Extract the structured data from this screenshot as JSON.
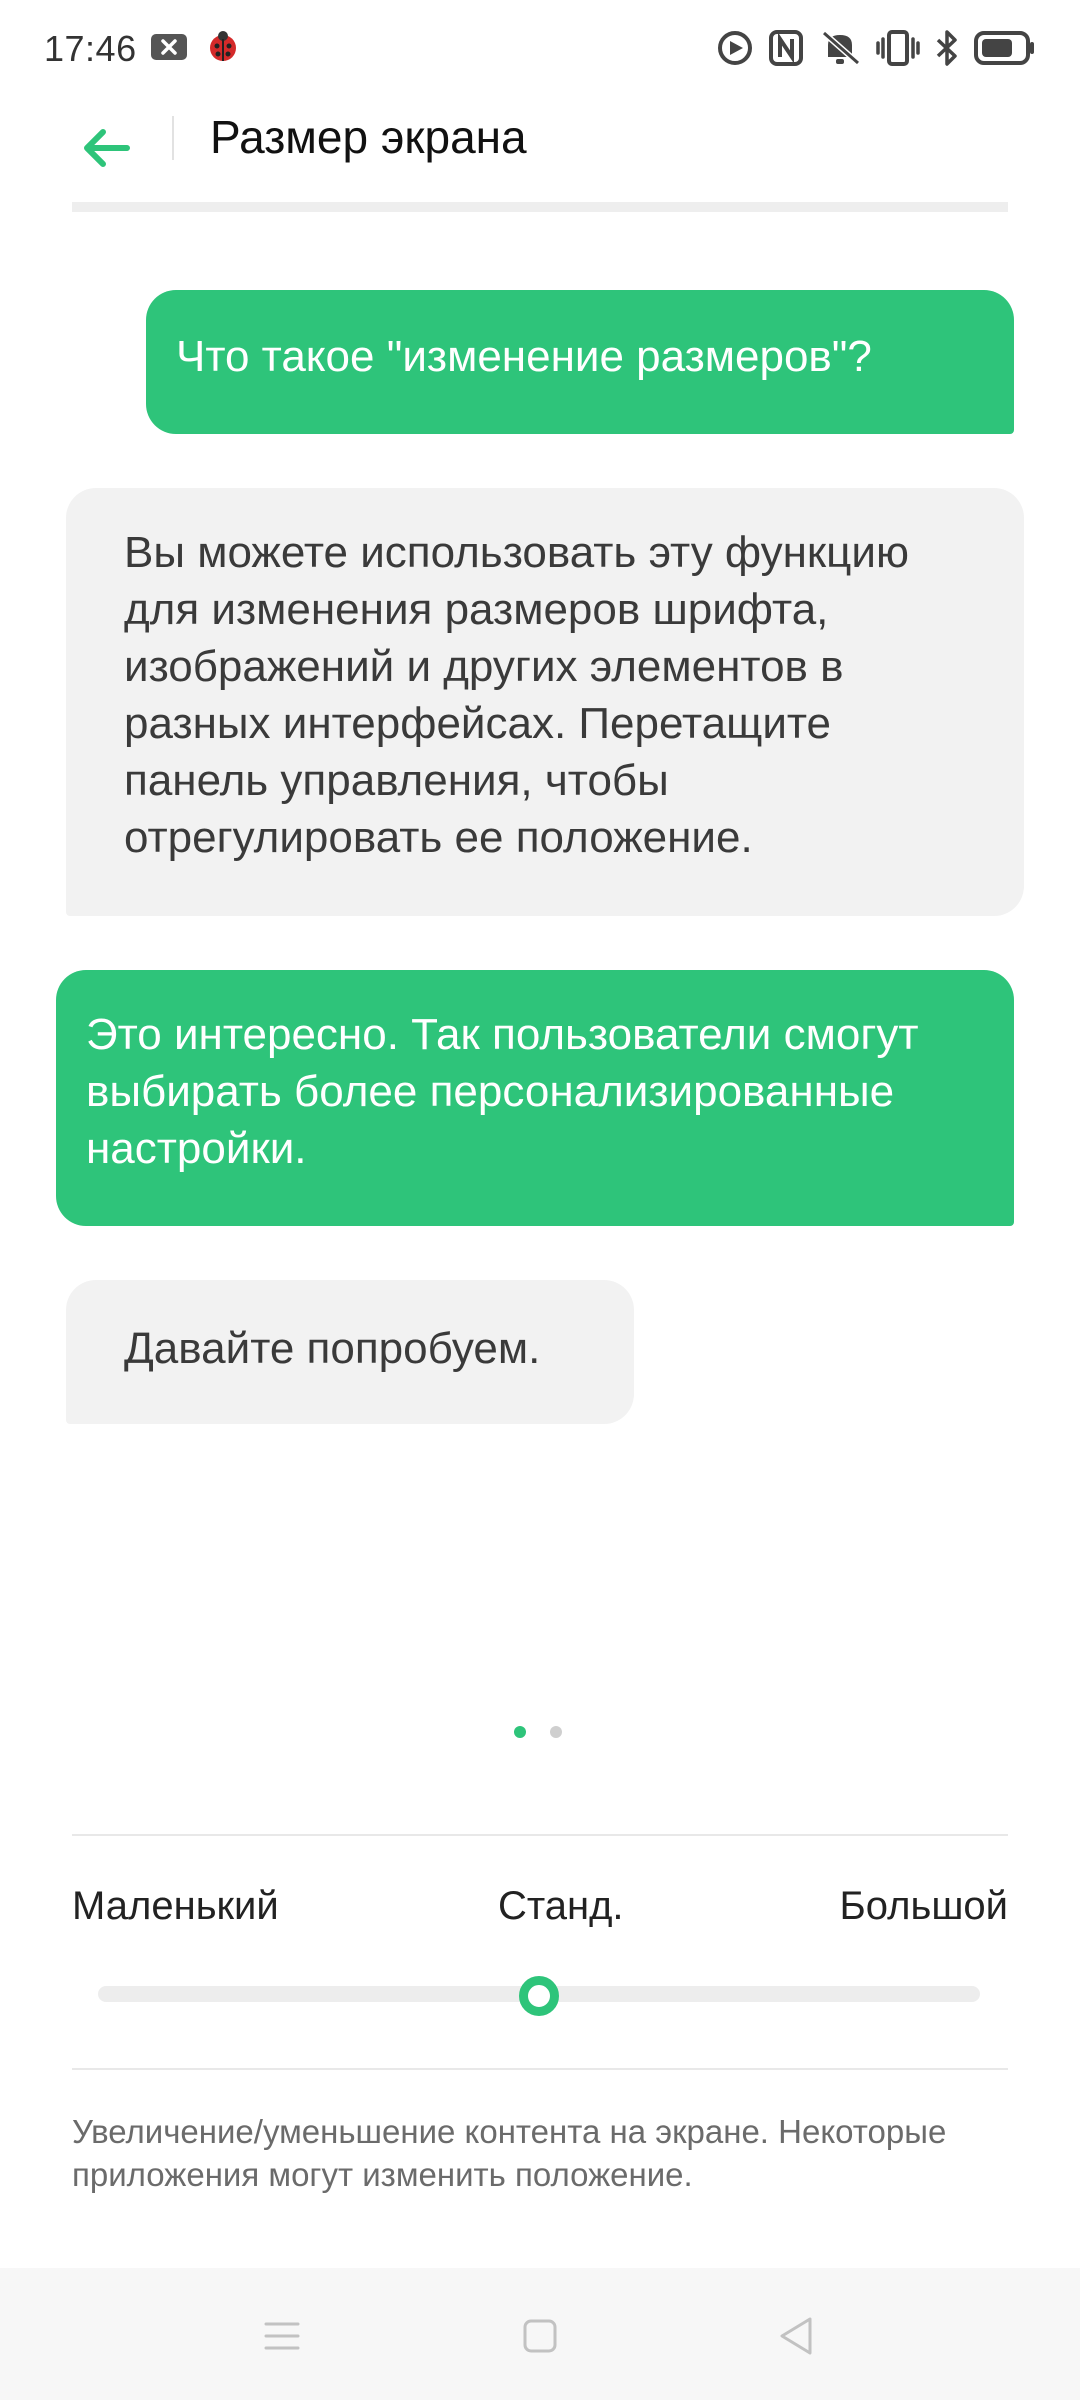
{
  "status_bar": {
    "time": "17:46",
    "left_icons": [
      "notification-close-icon",
      "ladybug-app-icon"
    ],
    "right_icons": [
      "do-not-disturb-icon",
      "nfc-icon",
      "vibrate-off-icon",
      "vibration-icon",
      "bluetooth-icon",
      "battery-icon"
    ]
  },
  "header": {
    "title": "Размер экрана",
    "back_icon": "arrow-left-icon"
  },
  "chat": {
    "bubble_1": "Что такое \"изменение размеров\"?",
    "bubble_2": "Вы можете использовать эту функцию для изменения размеров шрифта, изображений и других элементов в разных интерфейсах. Перетащите панель управления, чтобы отрегулировать ее положение.",
    "bubble_3": "Это интересно. Так пользователи смогут выбирать более персонализированные настройки.",
    "bubble_4": "Давайте попробуем."
  },
  "pager": {
    "pages": 2,
    "current": 1
  },
  "size_selector": {
    "small_label": "Маленький",
    "standard_label": "Станд.",
    "large_label": "Большой",
    "current_position_fraction": 0.5
  },
  "note": "Увеличение/уменьшение контента на экране. Некоторые приложения могут изменить положение.",
  "colors": {
    "accent": "#2ec47a",
    "bubble_gray": "#f2f2f2",
    "text_secondary": "#6b6b6b"
  },
  "nav_bar": {
    "icons": [
      "menu-icon",
      "home-icon",
      "back-triangle-icon"
    ]
  }
}
